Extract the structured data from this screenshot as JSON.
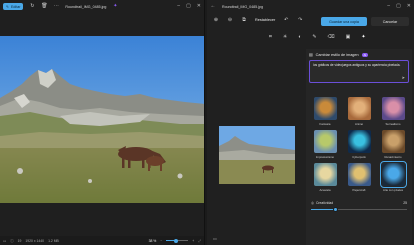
{
  "window1": {
    "edit_label": "Editar",
    "filename": "Roundtrail_IMG_0485.jpg",
    "status": {
      "index": "19",
      "dimensions": "1920 x 1440",
      "size": "1.2 MB",
      "zoom": "38 %",
      "zoom_level": 0.35
    }
  },
  "window2": {
    "filename": "Roundtrail_IMG_0485.jpg",
    "reset_label": "Restablecer",
    "save_label": "Guardar una copia",
    "cancel_label": "Cancelar",
    "panel": {
      "title": "Cambiar estilo de imagen",
      "badge": "AI",
      "prompt": "los gráficos de videojuegos antiguos y su apariencia pixelada.",
      "styles": [
        {
          "label": "Fantasía"
        },
        {
          "label": "Animé"
        },
        {
          "label": "Surrealismo"
        },
        {
          "label": "Impresionismo"
        },
        {
          "label": "Cyberpunk"
        },
        {
          "label": "Renacimiento"
        },
        {
          "label": "Acuarela"
        },
        {
          "label": "Papercraft"
        },
        {
          "label": "Arte con píxeles",
          "selected": true
        }
      ],
      "creativity_label": "Creatividad",
      "creativity_value": "25",
      "creativity_fraction": 0.25
    }
  },
  "colors": {
    "accent": "#4aa8e8",
    "ai_purple": "#8b5cf6"
  }
}
